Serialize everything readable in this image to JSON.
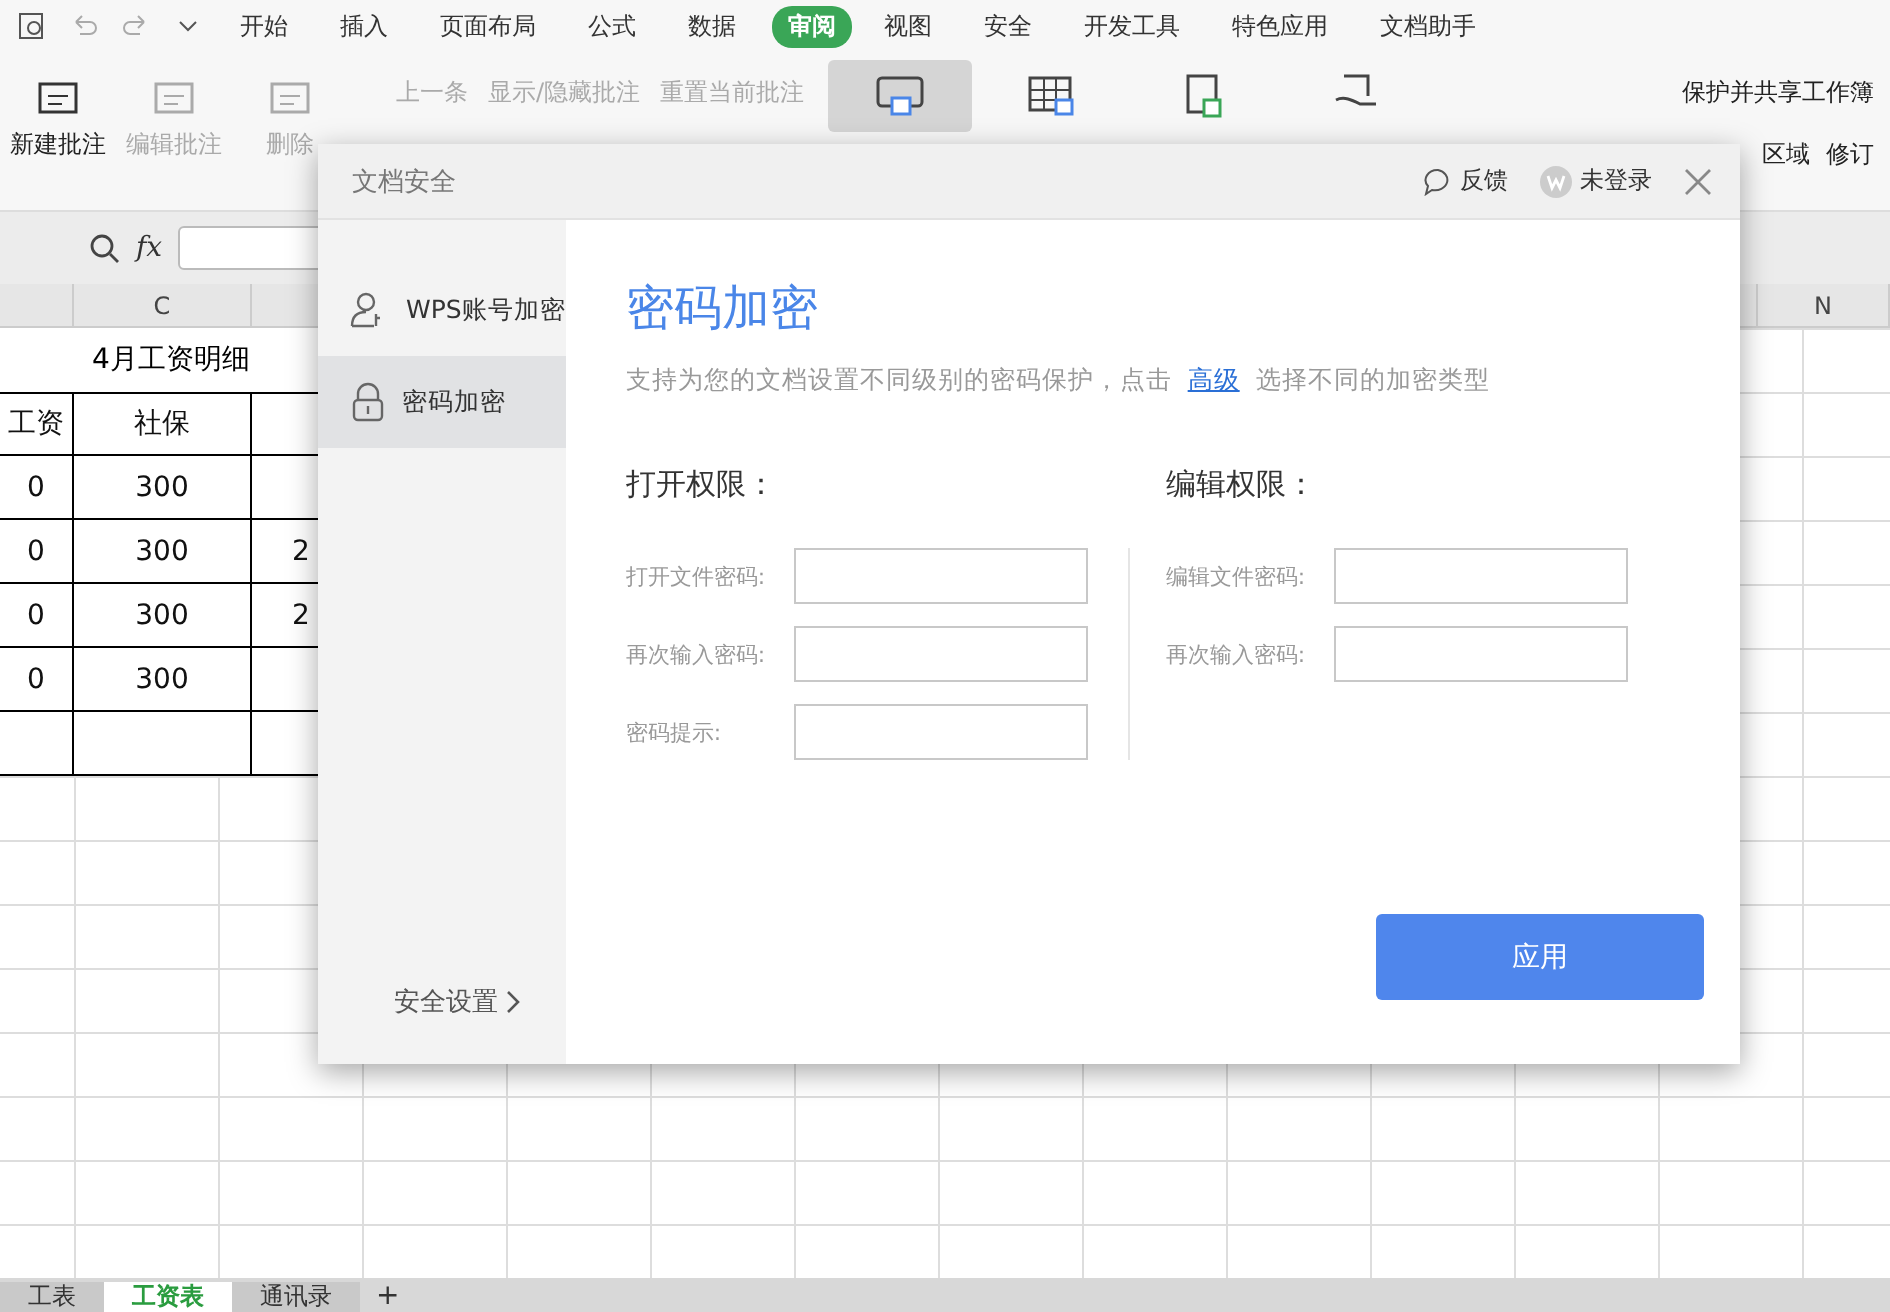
{
  "menu": [
    {
      "label": "开始",
      "selected": false
    },
    {
      "label": "插入",
      "selected": false
    },
    {
      "label": "页面布局",
      "selected": false
    },
    {
      "label": "公式",
      "selected": false
    },
    {
      "label": "数据",
      "selected": false
    },
    {
      "label": "审阅",
      "selected": true
    },
    {
      "label": "视图",
      "selected": false
    },
    {
      "label": "安全",
      "selected": false
    },
    {
      "label": "开发工具",
      "selected": false
    },
    {
      "label": "特色应用",
      "selected": false
    },
    {
      "label": "文档助手",
      "selected": false
    }
  ],
  "toolbar": {
    "big": [
      {
        "label": "新建批注",
        "disabled": false
      },
      {
        "label": "编辑批注",
        "disabled": true
      },
      {
        "label": "删除",
        "disabled": true
      }
    ],
    "small": [
      {
        "label": "上一条",
        "disabled": true
      },
      {
        "label": "显示/隐藏批注",
        "disabled": true
      },
      {
        "label": "重置当前批注",
        "disabled": true
      }
    ],
    "protect": [
      {
        "kind": "doc",
        "selected": true
      },
      {
        "kind": "sheet",
        "selected": false
      },
      {
        "kind": "book",
        "selected": false
      },
      {
        "kind": "share",
        "selected": false
      }
    ],
    "share_workbook": "保护并共享工作簿",
    "area": "区域",
    "revise": "修订"
  },
  "formula_bar": {
    "fx": "fx"
  },
  "column_headers": [
    "C",
    "N"
  ],
  "sheet": {
    "title": "4月工资明细",
    "header": [
      "工资",
      "社保"
    ],
    "rows": [
      [
        "0",
        "300",
        ""
      ],
      [
        "0",
        "300",
        "2"
      ],
      [
        "0",
        "300",
        "2"
      ],
      [
        "0",
        "300",
        ""
      ],
      [
        "",
        "",
        ""
      ]
    ]
  },
  "sheet_tabs": [
    {
      "label": "工表",
      "selected": false
    },
    {
      "label": "工资表",
      "selected": true
    },
    {
      "label": "通讯录",
      "selected": false
    }
  ],
  "add_sheet": "+",
  "dialog": {
    "title": "文档安全",
    "feedback": "反馈",
    "login": "未登录",
    "sidebar": [
      {
        "kind": "account",
        "label": "WPS账号加密",
        "selected": false
      },
      {
        "kind": "lock",
        "label": "密码加密",
        "selected": true
      }
    ],
    "security_settings": "安全设置",
    "heading": "密码加密",
    "description_before": "支持为您的文档设置不同级别的密码保护，点击",
    "link": "高级",
    "description_after": "选择不同的加密类型",
    "columns": [
      {
        "title": "打开权限：",
        "fields": [
          "打开文件密码:",
          "再次输入密码:",
          "密码提示:"
        ]
      },
      {
        "title": "编辑权限：",
        "fields": [
          "编辑文件密码:",
          "再次输入密码:"
        ]
      }
    ],
    "apply": "应用"
  }
}
